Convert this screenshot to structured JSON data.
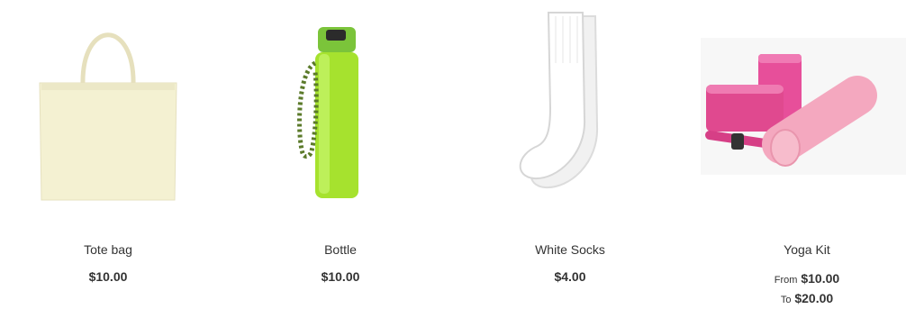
{
  "products": [
    {
      "name": "Tote bag",
      "price": "$10.00",
      "image": "tote-bag-image"
    },
    {
      "name": "Bottle",
      "price": "$10.00",
      "image": "bottle-image"
    },
    {
      "name": "White Socks",
      "price": "$4.00",
      "image": "socks-image"
    },
    {
      "name": "Yoga Kit",
      "image": "yoga-kit-image",
      "price_from_label": "From",
      "price_from": "$10.00",
      "price_to_label": "To",
      "price_to": "$20.00"
    }
  ]
}
